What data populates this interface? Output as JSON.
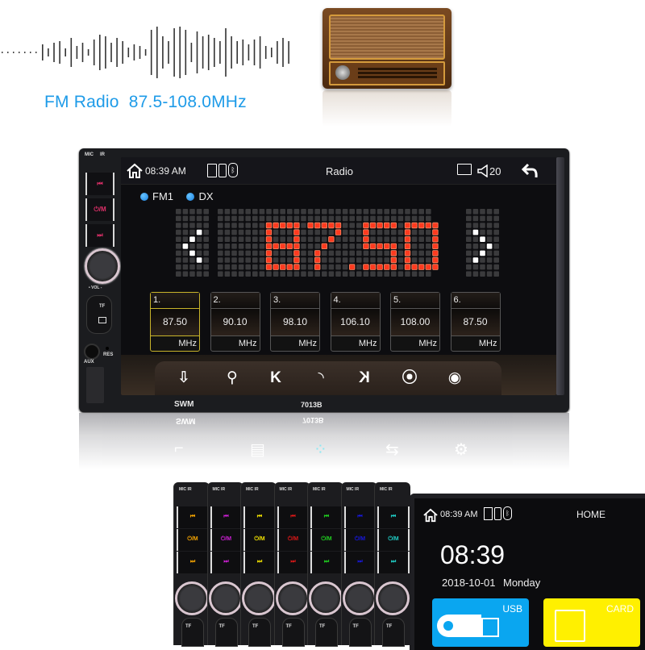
{
  "headline": {
    "tagline": "FM Radio  87.5-108.0MHz",
    "accent_color": "#1e9be8"
  },
  "device": {
    "brand": "SWM",
    "model": "7013B",
    "side_panel": {
      "mic_label": "MIC",
      "ir_label": "IR",
      "buttons": [
        {
          "icon": "prev-track-icon",
          "glyph": "⏮"
        },
        {
          "icon": "power-mode-icon",
          "glyph": "⏻/M"
        },
        {
          "icon": "next-track-icon",
          "glyph": "⏭"
        }
      ],
      "button_color": "#e0306a",
      "vol_label": "• VOL -",
      "tf_label": "TF",
      "aux_label": "AUX",
      "res_label": "RES"
    },
    "status_bar": {
      "home_icon": "home-icon",
      "time": "08:39 AM",
      "indicators": [
        "sd-card-icon",
        "usb-icon",
        "bluetooth-icon"
      ],
      "title": "Radio",
      "screen_icon": "screen-settings-icon",
      "volume_icon": "volume-icon",
      "volume": "20",
      "back_icon": "back-arrow-icon"
    },
    "bands": [
      {
        "label": "FM1",
        "active": true
      },
      {
        "label": "DX",
        "active": true
      }
    ],
    "frequency_display": {
      "value": "87.50",
      "color": "#ff3a1f",
      "prev_icon": "chevron-left-icon",
      "next_icon": "chevron-right-icon"
    },
    "presets": [
      {
        "number": "1.",
        "frequency": "87.50",
        "unit": "MHz",
        "selected": true
      },
      {
        "number": "2.",
        "frequency": "90.10",
        "unit": "MHz",
        "selected": false
      },
      {
        "number": "3.",
        "frequency": "98.10",
        "unit": "MHz",
        "selected": false
      },
      {
        "number": "4.",
        "frequency": "106.10",
        "unit": "MHz",
        "selected": false
      },
      {
        "number": "5.",
        "frequency": "108.00",
        "unit": "MHz",
        "selected": false
      },
      {
        "number": "6.",
        "frequency": "87.50",
        "unit": "MHz",
        "selected": false
      }
    ],
    "toolbar": [
      {
        "name": "save-preset-icon",
        "glyph": "⇩"
      },
      {
        "name": "search-icon",
        "glyph": "⚲"
      },
      {
        "name": "seek-back-icon",
        "glyph": "K"
      },
      {
        "name": "rds-signal-icon",
        "glyph": "◝"
      },
      {
        "name": "seek-forward-icon",
        "glyph": "K"
      },
      {
        "name": "stereo-antenna-icon",
        "glyph": "⦿"
      },
      {
        "name": "eye-icon",
        "glyph": "◉"
      }
    ]
  },
  "reflection_icons": [
    {
      "name": "reflection-icon-1",
      "glyph": "⌐",
      "color": "#ffffff"
    },
    {
      "name": "reflection-icon-2",
      "glyph": "▤",
      "color": "#ffffff"
    },
    {
      "name": "reflection-icon-3",
      "glyph": "⁘",
      "color": "#7fe6f2"
    },
    {
      "name": "reflection-icon-4",
      "glyph": "⇆",
      "color": "#ffffff"
    },
    {
      "name": "reflection-icon-5",
      "glyph": "⚙",
      "color": "#ffffff"
    }
  ],
  "lineup": {
    "unit_colors": [
      "#f5a400",
      "#d020d8",
      "#f0e000",
      "#e01818",
      "#20d020",
      "#1818e0",
      "#20d0c8"
    ],
    "mic_ir_label": "MIC  IR",
    "tf_label": "TF"
  },
  "home_screen": {
    "time_small": "08:39 AM",
    "title": "HOME",
    "clock": "08:39",
    "date": "2018-10-01",
    "weekday": "Monday",
    "tiles": [
      {
        "label": "USB",
        "color": "#0aa6f0",
        "icon": "usb-drive-icon"
      },
      {
        "label": "CARD",
        "color": "#fff000",
        "icon": "sd-card-icon"
      }
    ]
  }
}
